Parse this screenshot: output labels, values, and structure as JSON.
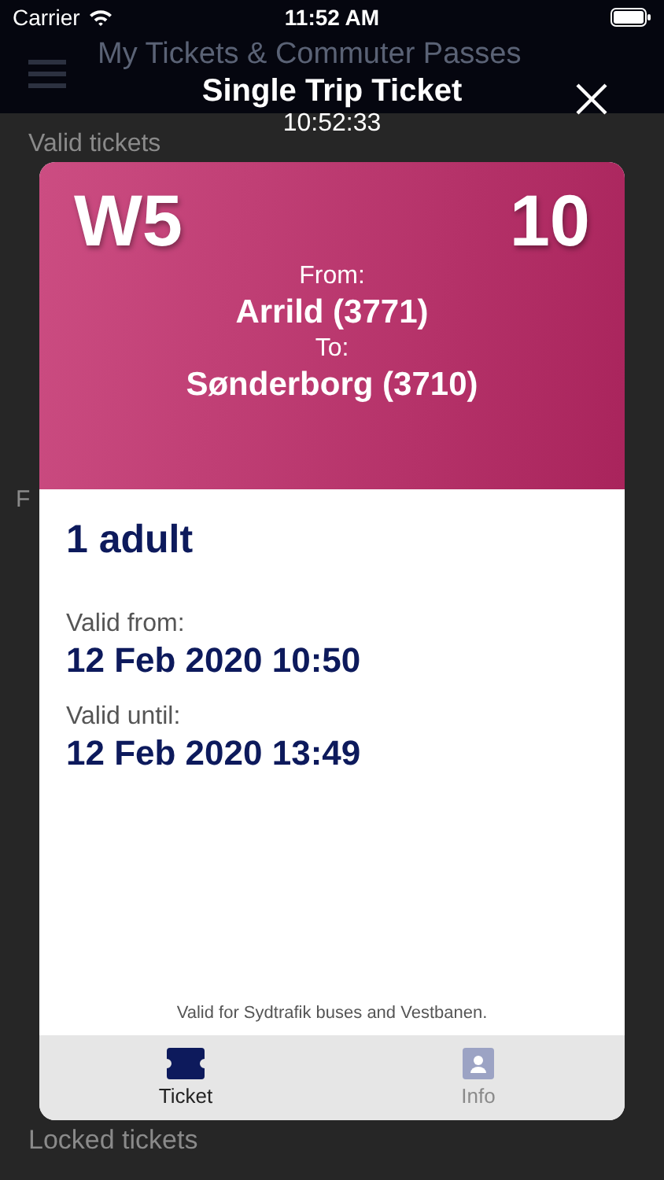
{
  "status_bar": {
    "carrier": "Carrier",
    "time": "11:52 AM"
  },
  "background": {
    "title": "My Tickets & Commuter Passes",
    "sections": [
      {
        "label": "Valid tickets"
      },
      {
        "label": "F"
      },
      {
        "label": "Locked tickets"
      }
    ]
  },
  "modal": {
    "title": "Single Trip Ticket",
    "clock": "10:52:33",
    "ticket": {
      "zone": "W5",
      "zones_count": "10",
      "from_label": "From:",
      "from": "Arrild (3771)",
      "to_label": "To:",
      "to": "Sønderborg (3710)",
      "passengers": "1 adult",
      "valid_from_label": "Valid from:",
      "valid_from": "12 Feb 2020 10:50",
      "valid_until_label": "Valid until:",
      "valid_until": "12 Feb 2020 13:49",
      "note": "Valid for Sydtrafik buses and Vestbanen."
    },
    "tabs": [
      {
        "label": "Ticket",
        "kind": "ticket",
        "selected": true
      },
      {
        "label": "Info",
        "kind": "info",
        "selected": false
      }
    ]
  }
}
